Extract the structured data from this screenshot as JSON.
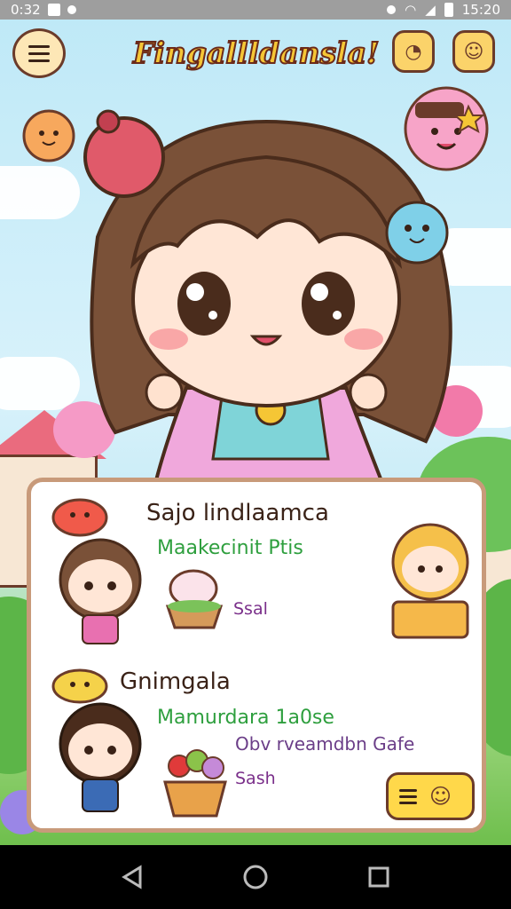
{
  "status_bar": {
    "time_left": "0:32",
    "time_right": "15:20"
  },
  "app": {
    "title": "Fingallldansla!"
  },
  "header": {
    "menu_icon": "hamburger-menu-icon",
    "button_1_icon": "cookie-icon",
    "button_2_icon": "chat-face-icon"
  },
  "cards": [
    {
      "title": "Sajo lindlaamca",
      "subtitle": "Maakecinit Ptis",
      "text": "Ssal"
    },
    {
      "title": "Gnimgala",
      "subtitle": "Mamurdara 1a0se",
      "text": "Obv rveamdbn Gafe",
      "text2": "Sash"
    }
  ],
  "colors": {
    "title_fill": "#f5c635",
    "title_outline": "#6b2a1a",
    "subtitle_green": "#2e9f3e",
    "text_purple": "#7a2f8a",
    "panel_border": "#c89a7a",
    "button_yellow": "#ffd84a"
  },
  "nav": {
    "back_icon": "back-triangle-icon",
    "home_icon": "home-circle-icon",
    "recents_icon": "recents-square-icon"
  }
}
